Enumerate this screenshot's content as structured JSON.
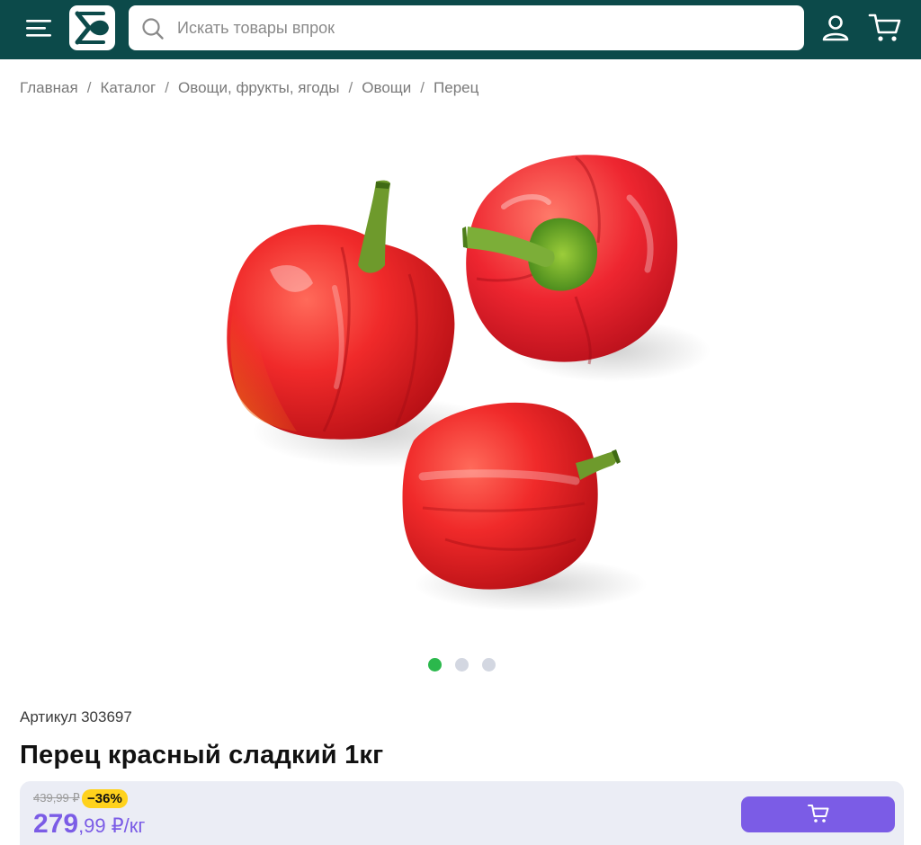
{
  "header": {
    "menu_icon": "hamburger-menu-icon",
    "logo_icon": "store-logo-icon",
    "search": {
      "placeholder": "Искать товары впрок",
      "value": ""
    },
    "user_icon": "user-profile-icon",
    "cart_icon": "shopping-cart-icon",
    "colors": {
      "background": "#0c4a4a",
      "icon": "#ffffff"
    }
  },
  "breadcrumb": {
    "items": [
      {
        "label": "Главная"
      },
      {
        "label": "Каталог"
      },
      {
        "label": "Овощи, фрукты, ягоды"
      },
      {
        "label": "Овощи"
      },
      {
        "label": "Перец"
      }
    ],
    "separator": "/"
  },
  "gallery": {
    "image": "red-bell-peppers-image",
    "slide_count": 3,
    "active_slide": 1,
    "colors": {
      "active_dot": "#2bb84c",
      "inactive_dot": "#d3d7e1"
    }
  },
  "product": {
    "sku_text": "Артикул 303697",
    "title": "Перец красный сладкий 1кг"
  },
  "pricing": {
    "old_price": "439,99 ₽",
    "discount": "−36%",
    "price_main": "279",
    "price_fraction": ",99",
    "price_unit": "₽/кг",
    "add_to_cart_icon": "cart-add-icon",
    "colors": {
      "accent": "#7b5ce6",
      "badge": "#ffd21c",
      "panel": "#ebedf5"
    }
  }
}
